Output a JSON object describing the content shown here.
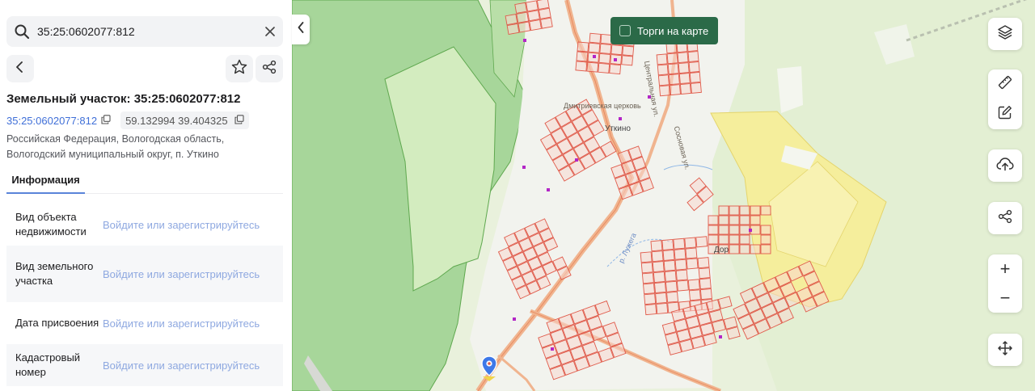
{
  "search": {
    "value": "35:25:0602077:812"
  },
  "parcel": {
    "title": "Земельный участок: 35:25:0602077:812",
    "cadastral_number": "35:25:0602077:812",
    "coordinates": "59.132994 39.404325",
    "address": "Российская Федерация, Вологодская область, Вологодский муниципальный округ, п. Уткино"
  },
  "tabs": [
    {
      "label": "Информация"
    }
  ],
  "info_rows": [
    {
      "label": "Вид объекта недвижимости",
      "value": "Войдите или зарегистрируйтесь"
    },
    {
      "label": "Вид земельного участка",
      "value": "Войдите или зарегистрируйтесь"
    },
    {
      "label": "Дата присвоения",
      "value": "Войдите или зарегистрируйтесь"
    },
    {
      "label": "Кадастровый номер",
      "value": "Войдите или зарегистрируйтесь"
    }
  ],
  "map": {
    "torgi_label": "Торги на карте",
    "zoom_in": "+",
    "zoom_out": "−",
    "labels": {
      "church": "Дмитриевская церковь",
      "village": "Уткино",
      "village2": "Дор",
      "river": "р. Лужега",
      "street1": "Центральная ул.",
      "street2": "Сосновая ул."
    }
  },
  "icons": [
    "search-icon",
    "clear-icon",
    "back-arrow-icon",
    "star-icon",
    "share-icon",
    "copy-icon",
    "chevron-left-icon",
    "layers-icon",
    "ruler-icon",
    "edit-icon",
    "upload-cloud-icon",
    "share-icon",
    "move-icon",
    "location-pin-icon"
  ],
  "colors": {
    "accent_link": "#3f6fd8",
    "link_disabled": "#8ea8e0",
    "parcel_stroke": "#e05a4a",
    "parcel_fill": "#f7d7cf",
    "torgi_bg": "#2b6a48",
    "forest": "#a7d69a",
    "meadow": "#d3ecbf",
    "yellow_zone": "#f5ee9c",
    "road": "#f0b48f"
  }
}
